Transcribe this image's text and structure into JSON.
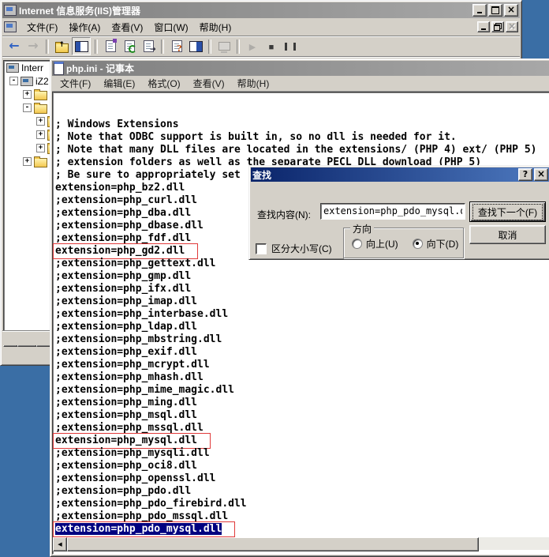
{
  "colors": {
    "desktop_bg": "#3A6EA5",
    "window_chrome": "#D4D0C8",
    "active_title_from": "#0A246A",
    "active_title_to": "#4E7AC0",
    "inactive_title_from": "#7E7E7E",
    "inactive_title_to": "#A9A9A9",
    "selection_bg": "#000080",
    "selection_fg": "#FFFFFF",
    "highlight_box_red": "#E03A3A"
  },
  "iis_window": {
    "title": "Internet 信息服务(IIS)管理器",
    "title_buttons": [
      {
        "name": "minimize-icon"
      },
      {
        "name": "maximize-icon"
      },
      {
        "name": "close-icon"
      }
    ],
    "menu_items": [
      "文件(F)",
      "操作(A)",
      "查看(V)",
      "窗口(W)",
      "帮助(H)"
    ],
    "mdi_buttons": [
      {
        "name": "minimize-icon"
      },
      {
        "name": "restore-icon"
      },
      {
        "name": "close-icon",
        "disabled": true
      }
    ],
    "toolbar_icons": [
      {
        "name": "back-icon"
      },
      {
        "name": "forward-icon",
        "disabled": true
      },
      {
        "sep": true
      },
      {
        "name": "up-folder-icon"
      },
      {
        "name": "show-tree-icon",
        "pressed": true
      },
      {
        "sep": true
      },
      {
        "name": "properties-icon",
        "page": true
      },
      {
        "name": "refresh-icon",
        "page": true
      },
      {
        "name": "export-list-icon",
        "page": true
      },
      {
        "sep": true
      },
      {
        "name": "help-icon",
        "page": true
      },
      {
        "name": "detail-pane-icon"
      },
      {
        "sep": true
      },
      {
        "name": "computer-connect-icon",
        "disabled": true
      },
      {
        "sep": true
      },
      {
        "name": "start-icon",
        "disabled": true
      },
      {
        "name": "stop-icon"
      },
      {
        "name": "pause-icon"
      }
    ],
    "tree_items": [
      {
        "label": "Interr",
        "level": 0,
        "expander": "",
        "icon": "iis-root-icon"
      },
      {
        "label": "iZ2",
        "level": 1,
        "expander": "-",
        "icon": "computer-icon"
      },
      {
        "label": "",
        "level": 2,
        "expander": "+",
        "icon": "folder-icon"
      },
      {
        "label": "",
        "level": 2,
        "expander": "-",
        "icon": "folder-icon"
      },
      {
        "label": "",
        "level": 3,
        "expander": "+",
        "icon": "folder-icon"
      },
      {
        "label": "",
        "level": 3,
        "expander": "+",
        "icon": "folder-icon"
      },
      {
        "label": "",
        "level": 3,
        "expander": "+",
        "icon": "folder-icon"
      },
      {
        "label": "",
        "level": 2,
        "expander": "+",
        "icon": "folder-icon"
      }
    ]
  },
  "notepad_window": {
    "title": "php.ini - 记事本",
    "menu_items": [
      "文件(F)",
      "编辑(E)",
      "格式(O)",
      "查看(V)",
      "帮助(H)"
    ],
    "editor_lines": [
      {
        "text": "; Windows Extensions"
      },
      {
        "text": "; Note that ODBC support is built in, so no dll is needed for it."
      },
      {
        "text": "; Note that many DLL files are located in the extensions/ (PHP 4) ext/ (PHP 5)"
      },
      {
        "text": "; extension folders as well as the separate PECL DLL download (PHP 5)"
      },
      {
        "text": "; Be sure to appropriately set"
      },
      {
        "text": "extension=php_bz2.dll"
      },
      {
        "text": ";extension=php_curl.dll"
      },
      {
        "text": ";extension=php_dba.dll"
      },
      {
        "text": ";extension=php_dbase.dll"
      },
      {
        "text": ";extension=php_fdf.dll"
      },
      {
        "text": "extension=php_gd2.dll",
        "boxed": true
      },
      {
        "text": ";extension=php_gettext.dll"
      },
      {
        "text": ";extension=php_gmp.dll"
      },
      {
        "text": ";extension=php_ifx.dll"
      },
      {
        "text": ";extension=php_imap.dll"
      },
      {
        "text": ";extension=php_interbase.dll"
      },
      {
        "text": ";extension=php_ldap.dll"
      },
      {
        "text": ";extension=php_mbstring.dll"
      },
      {
        "text": ";extension=php_exif.dll"
      },
      {
        "text": ";extension=php_mcrypt.dll"
      },
      {
        "text": ";extension=php_mhash.dll"
      },
      {
        "text": ";extension=php_mime_magic.dll"
      },
      {
        "text": ";extension=php_ming.dll"
      },
      {
        "text": ";extension=php_msql.dll"
      },
      {
        "text": ";extension=php_mssql.dll"
      },
      {
        "text": "extension=php_mysql.dll",
        "boxed": true
      },
      {
        "text": ";extension=php_mysqli.dll"
      },
      {
        "text": ";extension=php_oci8.dll"
      },
      {
        "text": ";extension=php_openssl.dll"
      },
      {
        "text": ";extension=php_pdo.dll"
      },
      {
        "text": ";extension=php_pdo_firebird.dll"
      },
      {
        "text": ";extension=php_pdo_mssql.dll"
      },
      {
        "text": "extension=php_pdo_mysql.dll",
        "boxed": true,
        "selected": true
      }
    ]
  },
  "find_dialog": {
    "title": "查找",
    "title_buttons": [
      {
        "name": "help-question-icon"
      },
      {
        "name": "close-icon"
      }
    ],
    "find_label": "查找内容(N):",
    "find_value": "extension=php_pdo_mysql.dll",
    "find_next_button": "查找下一个(F)",
    "cancel_button": "取消",
    "match_case_label": "区分大小写(C)",
    "match_case_checked": false,
    "direction_group": {
      "label": "方向",
      "up_label": "向上(U)",
      "down_label": "向下(D)",
      "selected": "down"
    }
  }
}
